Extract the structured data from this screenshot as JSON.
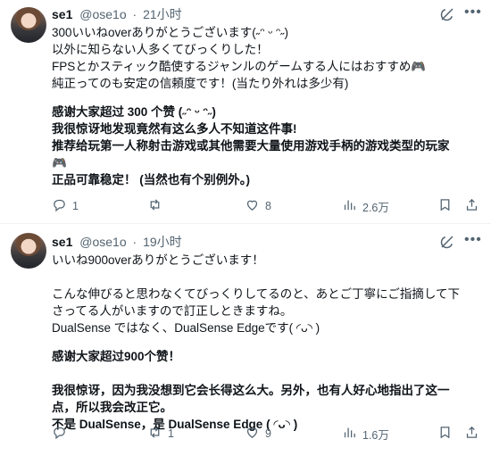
{
  "tweets": [
    {
      "author_name": "se1",
      "author_handle": "@ose1o",
      "separator": "·",
      "timestamp": "21小时",
      "lines": [
        "300いいねoverありがとうございます(˶ᵔ ᵕ ᵔ˶)",
        "以外に知らない人多くてびっくりした！",
        "FPSとかスティック酷使するジャンルのゲームする人にはおすすめ🎮",
        "純正ってのも安定の信頼度です！(当たり外れは多少有)",
        "感谢大家超过 300 个赞 (˶ᵔ ᵕ ᵔ˶)",
        "我很惊讶地发现竟然有这么多人不知道这件事!",
        "推荐给玩第一人称射击游戏或其他需要大量使用游戏手柄的游戏类型的玩家",
        "🎮",
        "正品可靠稳定！ (当然也有个别例外。)"
      ],
      "replies": "1",
      "retweets": "",
      "likes": "8",
      "views": "2.6万"
    },
    {
      "author_name": "se1",
      "author_handle": "@ose1o",
      "separator": "·",
      "timestamp": "19小时",
      "lines": [
        "いいね900overありがとうございます！",
        "こんな伸びると思わなくてびっくりしてるのと、あとご丁寧にご指摘して下",
        "さってる人がいますので訂正しときますね。",
        "DualSense ではなく、DualSense Edgeです( ◜ᴗ◝ )",
        "感谢大家超过900个赞！",
        "我很惊讶，因为我没想到它会长得这么大。另外，也有人好心地指出了这一",
        "点，所以我会改正它。",
        "不是 DualSense，是 DualSense Edge ( ◜ᴗ◝ )"
      ],
      "replies": "",
      "retweets": "1",
      "likes": "9",
      "views": "1.6万"
    }
  ],
  "icons": {
    "reply": "reply-icon",
    "retweet": "retweet-icon",
    "like": "heart-icon",
    "views": "views-icon",
    "bookmark": "bookmark-icon",
    "share": "share-icon",
    "grok": "grok-icon",
    "more": "more-icon"
  },
  "colors": {
    "text": "#0f1419",
    "secondary": "#536471",
    "divider": "#eff3f4"
  }
}
